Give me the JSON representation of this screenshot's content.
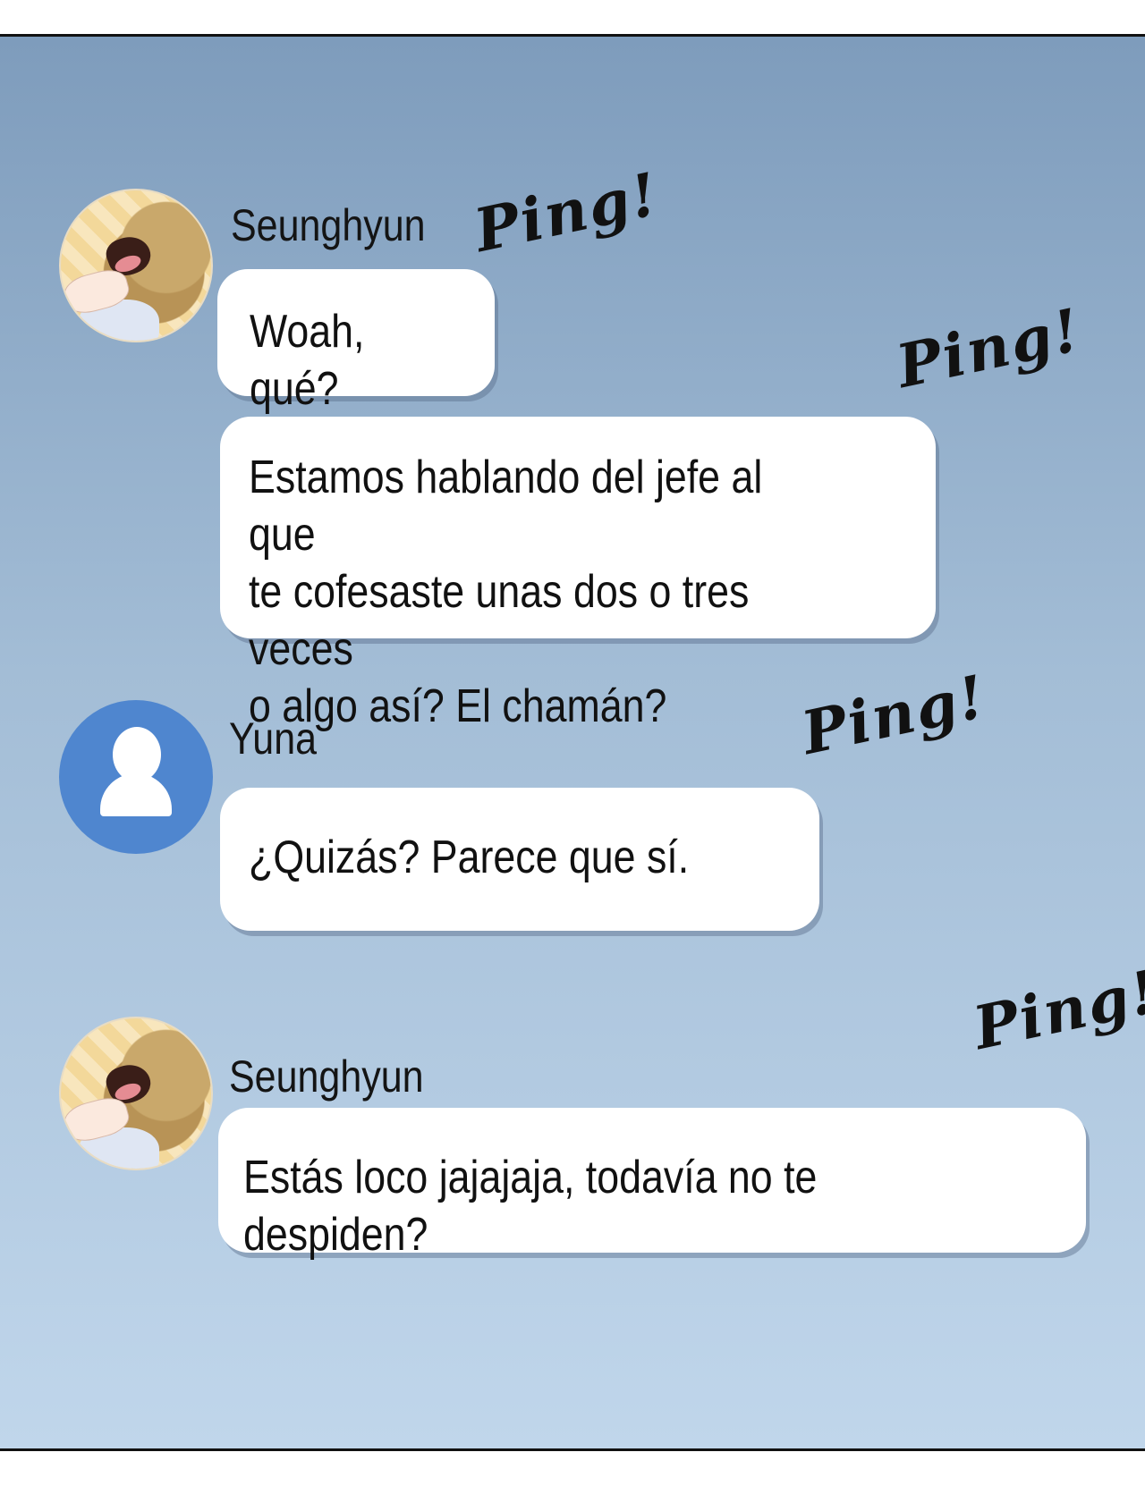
{
  "messages": [
    {
      "sender": "Seunghyun",
      "avatar": "dog-photo-avatar",
      "bubbles": [
        "Woah, qué?",
        "Estamos hablando del jefe al que\nte cofesaste unas dos o tres veces\no algo así? El chamán?"
      ]
    },
    {
      "sender": "Yuna",
      "avatar": "default-user-avatar",
      "bubbles": [
        "¿Quizás? Parece que sí."
      ]
    },
    {
      "sender": "Seunghyun",
      "avatar": "dog-photo-avatar",
      "bubbles": [
        "Estás loco jajajaja, todavía no te despiden?"
      ]
    }
  ],
  "sfx": [
    "Ping!",
    "Ping!",
    "Ping!",
    "Ping!"
  ],
  "colors": {
    "panel_top": "#7e9cbc",
    "panel_bottom": "#c0d6eb",
    "default_avatar": "#4f86cf",
    "bubble": "#ffffff"
  }
}
